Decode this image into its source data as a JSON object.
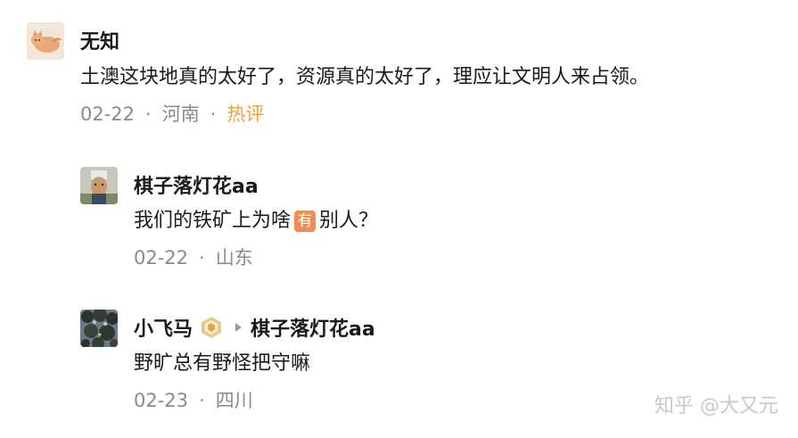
{
  "comments": [
    {
      "author": "无知",
      "content": "土澳这块地真的太好了，资源真的太好了，理应让文明人来占领。",
      "date": "02-22",
      "location": "河南",
      "tag": "热评"
    },
    {
      "author": "棋子落灯花aa",
      "content_before": "我们的铁矿上为啥",
      "content_badge": "有",
      "content_after": "别人？",
      "date": "02-22",
      "location": "山东"
    },
    {
      "author": "小飞马",
      "reply_to": "棋子落灯花aa",
      "content": "野旷总有野怪把守嘛",
      "date": "02-23",
      "location": "四川"
    }
  ],
  "separator": "·",
  "watermark": "知乎 @大又元",
  "colors": {
    "hot_tag": "#f0a03c",
    "badge_bg": "#f28c50",
    "meta_text": "#8a8a8a"
  },
  "icons": {
    "medal": "hexagon-medal-icon",
    "reply_arrow": "reply-arrow-icon"
  }
}
